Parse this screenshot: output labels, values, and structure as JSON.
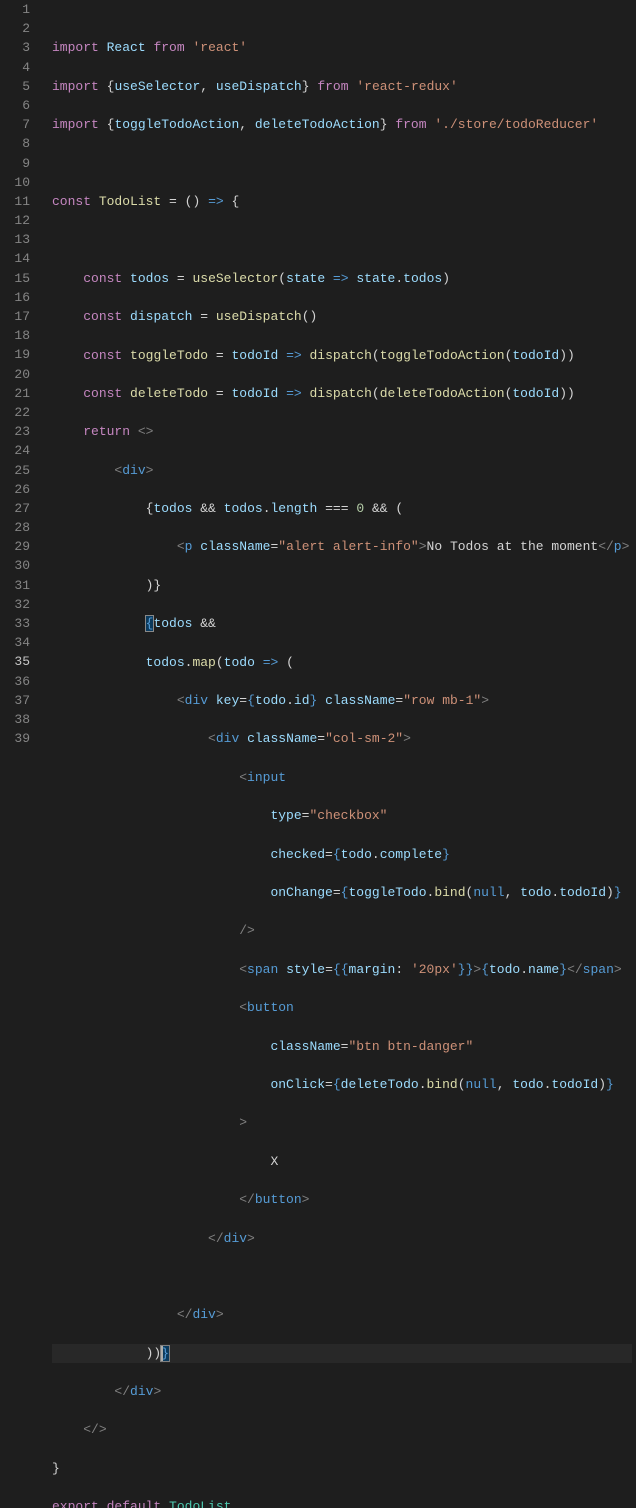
{
  "line_count": 39,
  "active_line": 35,
  "lines": {
    "l1": {
      "kw1": "import",
      "sp1": " ",
      "id1": "React",
      "sp2": " ",
      "kw2": "from",
      "sp3": " ",
      "str": "'react'"
    },
    "l2": {
      "kw1": "import",
      "sp1": " ",
      "op1": "{",
      "id1": "useSelector",
      "op2": ", ",
      "id2": "useDispatch",
      "op3": "}",
      "sp2": " ",
      "kw2": "from",
      "sp3": " ",
      "str": "'react-redux'"
    },
    "l3": {
      "kw1": "import",
      "sp1": " ",
      "op1": "{",
      "id1": "toggleTodoAction",
      "op2": ", ",
      "id2": "deleteTodoAction",
      "op3": "}",
      "sp2": " ",
      "kw2": "from",
      "sp3": " ",
      "str": "'./store/todoReducer'"
    },
    "l5": {
      "kw1": "const",
      "sp": " ",
      "cls": "TodoList",
      "eq": " = ",
      "paren": "()",
      "arrow": " => ",
      "brace": "{"
    },
    "l7": {
      "indent": "    ",
      "kw": "const",
      "sp": " ",
      "id": "todos",
      "eq": " = ",
      "fn": "useSelector",
      "p1": "(",
      "arg": "state",
      "arrow": " => ",
      "obj": "state",
      "dot": ".",
      "prop": "todos",
      "p2": ")"
    },
    "l8": {
      "indent": "    ",
      "kw": "const",
      "sp": " ",
      "id": "dispatch",
      "eq": " = ",
      "fn": "useDispatch",
      "parens": "()"
    },
    "l9": {
      "indent": "    ",
      "kw": "const",
      "sp": " ",
      "fn1": "toggleTodo",
      "eq": " = ",
      "arg": "todoId",
      "arrow": " => ",
      "fn2": "dispatch",
      "p1": "(",
      "fn3": "toggleTodoAction",
      "p2": "(",
      "arg2": "todoId",
      "p3": "))"
    },
    "l10": {
      "indent": "    ",
      "kw": "const",
      "sp": " ",
      "fn1": "deleteTodo",
      "eq": " = ",
      "arg": "todoId",
      "arrow": " => ",
      "fn2": "dispatch",
      "p1": "(",
      "fn3": "deleteTodoAction",
      "p2": "(",
      "arg2": "todoId",
      "p3": "))"
    },
    "l11": {
      "indent": "    ",
      "kw": "return",
      "sp": " ",
      "frag": "<>"
    },
    "l12": {
      "indent": "        ",
      "lt": "<",
      "tag": "div",
      "gt": ">"
    },
    "l13": {
      "indent": "            ",
      "ob": "{",
      "id": "todos",
      "and": " && ",
      "id2": "todos",
      "dot": ".",
      "prop": "length",
      "eqop": " === ",
      "num": "0",
      "and2": " && ",
      "paren": "("
    },
    "l14": {
      "indent": "                ",
      "lt": "<",
      "tag": "p",
      "sp": " ",
      "attr": "className",
      "eq": "=",
      "str": "\"alert alert-info\"",
      "gt": ">",
      "txt": "No Todos at the moment",
      "lt2": "</",
      "tag2": "p",
      "gt2": ">"
    },
    "l15": {
      "indent": "            ",
      "close": ")}"
    },
    "l16": {
      "indent": "            ",
      "ob": "{",
      "id": "todos",
      "and": " &&"
    },
    "l17": {
      "indent": "            ",
      "id": "todos",
      "dot": ".",
      "fn": "map",
      "p1": "(",
      "arg": "todo",
      "arrow": " => ",
      "p2": "("
    },
    "l18": {
      "indent": "                ",
      "lt": "<",
      "tag": "div",
      "sp": " ",
      "attr1": "key",
      "eq1": "=",
      "ob": "{",
      "obj": "todo",
      "dot": ".",
      "prop": "id",
      "cb": "}",
      "sp2": " ",
      "attr2": "className",
      "eq2": "=",
      "str": "\"row mb-1\"",
      "gt": ">"
    },
    "l19": {
      "indent": "                    ",
      "lt": "<",
      "tag": "div",
      "sp": " ",
      "attr": "className",
      "eq": "=",
      "str": "\"col-sm-2\"",
      "gt": ">"
    },
    "l20": {
      "indent": "                        ",
      "lt": "<",
      "tag": "input"
    },
    "l21": {
      "indent": "                            ",
      "attr": "type",
      "eq": "=",
      "str": "\"checkbox\""
    },
    "l22": {
      "indent": "                            ",
      "attr": "checked",
      "eq": "=",
      "ob": "{",
      "obj": "todo",
      "dot": ".",
      "prop": "complete",
      "cb": "}"
    },
    "l23": {
      "indent": "                            ",
      "attr": "onChange",
      "eq": "=",
      "ob": "{",
      "obj": "toggleTodo",
      "dot": ".",
      "fn": "bind",
      "p1": "(",
      "nul": "null",
      "comma": ", ",
      "obj2": "todo",
      "dot2": ".",
      "prop": "todoId",
      "p2": ")",
      "cb": "}"
    },
    "l24": {
      "indent": "                        ",
      "close": "/>"
    },
    "l25": {
      "indent": "                        ",
      "lt": "<",
      "tag": "span",
      "sp": " ",
      "attr": "style",
      "eq": "=",
      "ob": "{{",
      "prop": "margin",
      "colon": ":",
      "sp2": " ",
      "str": "'20px'",
      "cb": "}}",
      "gt": ">",
      "ob2": "{",
      "obj": "todo",
      "dot": ".",
      "prop2": "name",
      "cb2": "}",
      "lt2": "</",
      "tag2": "span",
      "gt2": ">"
    },
    "l26": {
      "indent": "                        ",
      "lt": "<",
      "tag": "button"
    },
    "l27": {
      "indent": "                            ",
      "attr": "className",
      "eq": "=",
      "str": "\"btn btn-danger\""
    },
    "l28": {
      "indent": "                            ",
      "attr": "onClick",
      "eq": "=",
      "ob": "{",
      "obj": "deleteTodo",
      "dot": ".",
      "fn": "bind",
      "p1": "(",
      "nul": "null",
      "comma": ", ",
      "obj2": "todo",
      "dot2": ".",
      "prop": "todoId",
      "p2": ")",
      "cb": "}"
    },
    "l29": {
      "indent": "                        ",
      "gt": ">"
    },
    "l30": {
      "indent": "                            ",
      "txt": "X"
    },
    "l31": {
      "indent": "                        ",
      "lt": "</",
      "tag": "button",
      "gt": ">"
    },
    "l32": {
      "indent": "                    ",
      "lt": "</",
      "tag": "div",
      "gt": ">"
    },
    "l34": {
      "indent": "                ",
      "lt": "</",
      "tag": "div",
      "gt": ">"
    },
    "l35": {
      "indent": "            ",
      "close": "))",
      "cb": "}"
    },
    "l36": {
      "indent": "        ",
      "lt": "</",
      "tag": "div",
      "gt": ">"
    },
    "l37": {
      "indent": "    ",
      "frag": "</>"
    },
    "l38": {
      "brace": "}"
    },
    "l39": {
      "kw1": "export",
      "sp": " ",
      "kw2": "default",
      "sp2": " ",
      "cls": "TodoList"
    }
  }
}
